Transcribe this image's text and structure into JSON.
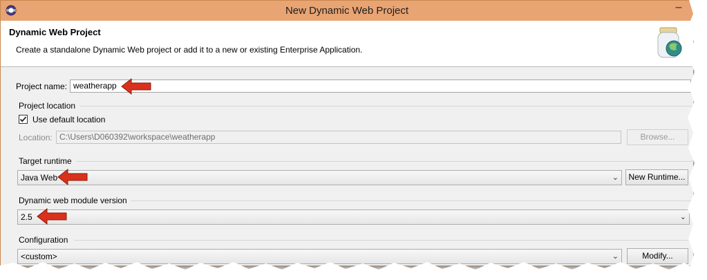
{
  "window": {
    "title": "New Dynamic Web Project",
    "minimize_glyph": "–"
  },
  "header": {
    "title": "Dynamic Web Project",
    "description": "Create a standalone Dynamic Web project or add it to a new or existing Enterprise Application."
  },
  "project_name": {
    "label": "Project name:",
    "value": "weatherapp"
  },
  "project_location": {
    "group_label": "Project location",
    "use_default_label": "Use default location",
    "use_default_checked": true,
    "location_label": "Location:",
    "location_value": "C:\\Users\\D060392\\workspace\\weatherapp",
    "browse_label": "Browse..."
  },
  "target_runtime": {
    "group_label": "Target runtime",
    "selected": "Java Web",
    "new_runtime_label": "New Runtime..."
  },
  "module_version": {
    "group_label": "Dynamic web module version",
    "selected": "2.5"
  },
  "configuration": {
    "group_label": "Configuration",
    "selected": "<custom>",
    "modify_label": "Modify..."
  },
  "colors": {
    "titlebar": "#e8a472",
    "annotation_arrow": "#d9311b"
  },
  "icons": [
    "eclipse-app-icon",
    "jar-globe-icon",
    "checkmark-icon",
    "dropdown-arrow-icon",
    "annotation-arrow-icon"
  ]
}
